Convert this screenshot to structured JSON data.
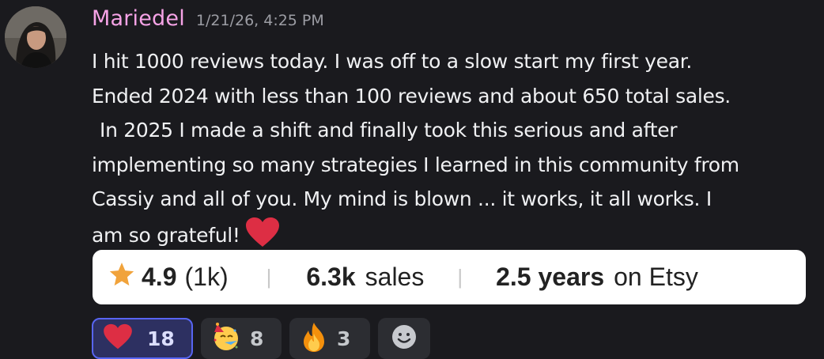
{
  "message": {
    "author": "Mariedel",
    "timestamp": "1/21/26, 4:25 PM",
    "lines": [
      "I hit 1000 reviews today.  I was off to a slow start my first year.",
      "Ended 2024 with less than 100  reviews and about 650 total sales.",
      "In 2025 I made a shift and finally took this serious and after",
      "implementing so many strategies I learned in this community from",
      "Cassiy and all of you.  My mind is blown ... it works, it all works.  I",
      "am so grateful!"
    ],
    "trailing_emoji": "red-heart"
  },
  "etsy_stats": {
    "rating": "4.9",
    "review_count": "(1k)",
    "sales_value": "6.3k",
    "sales_label": "sales",
    "years_value": "2.5 years",
    "years_label": "on Etsy"
  },
  "reactions": [
    {
      "emoji": "red-heart",
      "count": "18",
      "selected": true
    },
    {
      "emoji": "partying-face",
      "count": "8",
      "selected": false
    },
    {
      "emoji": "fire",
      "count": "3",
      "selected": false
    }
  ],
  "colors": {
    "background": "#1a1a1e",
    "username": "#f6a3e6",
    "timestamp": "#9c9da4",
    "message_text": "#f0f1f3",
    "heart": "#dd2e44",
    "star": "#f1a33b",
    "selected_reaction_border": "#5865f2",
    "selected_reaction_bg": "#2d3061"
  }
}
